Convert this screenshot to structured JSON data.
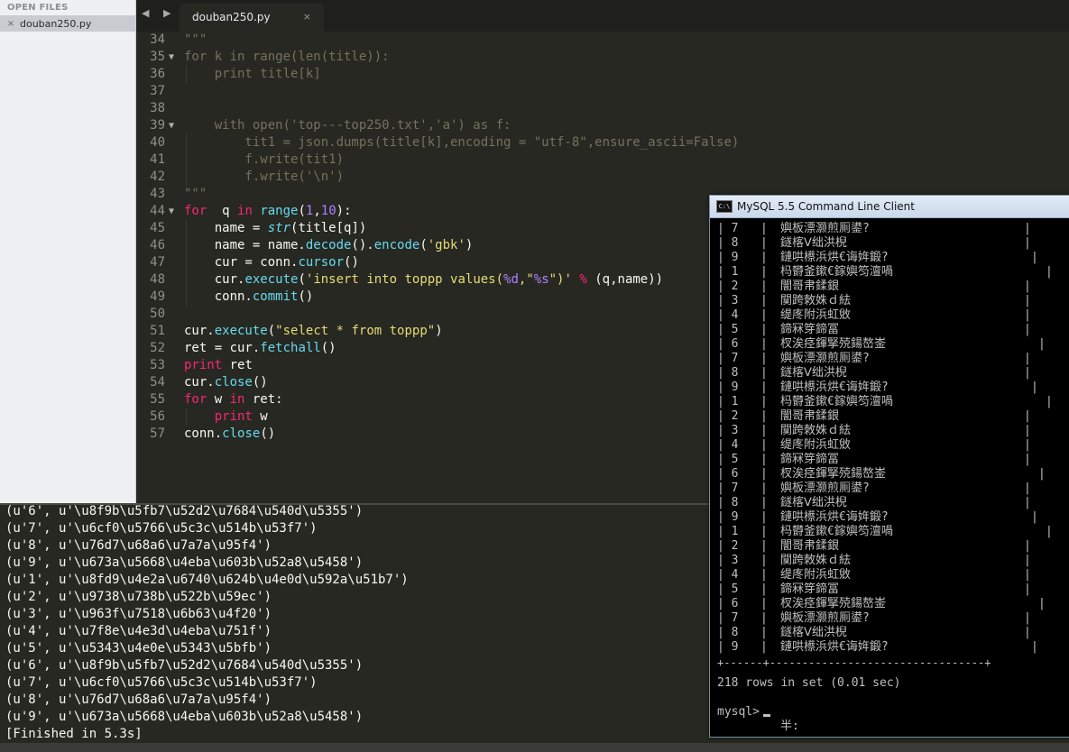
{
  "sidebar": {
    "header": "OPEN FILES",
    "close_icon": "×",
    "file": "douban250.py"
  },
  "tab": {
    "label": "douban250.py",
    "close": "×"
  },
  "nav": {
    "arrows": "◀ ▶"
  },
  "editor": {
    "lines": [
      {
        "n": "34",
        "fold": false,
        "tokens": [
          [
            "cm",
            "\"\"\""
          ]
        ]
      },
      {
        "n": "35",
        "fold": true,
        "tokens": [
          [
            "cm",
            "for k in range(len(title)):"
          ]
        ]
      },
      {
        "n": "36",
        "fold": false,
        "tokens": [
          [
            "cm",
            "    print title[k]"
          ]
        ]
      },
      {
        "n": "37",
        "fold": false,
        "tokens": []
      },
      {
        "n": "38",
        "fold": false,
        "tokens": []
      },
      {
        "n": "39",
        "fold": true,
        "tokens": [
          [
            "cm",
            "    with open('top---top250.txt','a') as f:"
          ]
        ]
      },
      {
        "n": "40",
        "fold": false,
        "tokens": [
          [
            "cm",
            "        tit1 = json.dumps(title[k],encoding = \"utf-8\",ensure_ascii=False)"
          ]
        ]
      },
      {
        "n": "41",
        "fold": false,
        "tokens": [
          [
            "cm",
            "        f.write(tit1)"
          ]
        ]
      },
      {
        "n": "42",
        "fold": false,
        "tokens": [
          [
            "cm",
            "        f.write('\\n')"
          ]
        ]
      },
      {
        "n": "43",
        "fold": false,
        "tokens": [
          [
            "cm",
            "\"\"\""
          ]
        ]
      },
      {
        "n": "44",
        "fold": true,
        "tokens": [
          [
            "kw",
            "for"
          ],
          [
            "",
            "  q "
          ],
          [
            "kw",
            "in"
          ],
          [
            "",
            " "
          ],
          [
            "fn",
            "range"
          ],
          [
            "",
            "("
          ],
          [
            "nm",
            "1"
          ],
          [
            "",
            ","
          ],
          [
            "nm",
            "10"
          ],
          [
            "",
            "):"
          ]
        ]
      },
      {
        "n": "45",
        "fold": false,
        "tokens": [
          [
            "",
            "    name = "
          ],
          [
            "bi",
            "str"
          ],
          [
            "",
            "(title[q])"
          ]
        ]
      },
      {
        "n": "46",
        "fold": false,
        "tokens": [
          [
            "",
            "    name = name."
          ],
          [
            "fn",
            "decode"
          ],
          [
            "",
            "()."
          ],
          [
            "fn",
            "encode"
          ],
          [
            "",
            "("
          ],
          [
            "st",
            "'gbk'"
          ],
          [
            "",
            ")"
          ]
        ]
      },
      {
        "n": "47",
        "fold": false,
        "tokens": [
          [
            "",
            "    cur = conn."
          ],
          [
            "fn",
            "cursor"
          ],
          [
            "",
            "()"
          ]
        ]
      },
      {
        "n": "48",
        "fold": false,
        "tokens": [
          [
            "",
            "    cur."
          ],
          [
            "fn",
            "execute"
          ],
          [
            "",
            "("
          ],
          [
            "st",
            "'insert into toppp values("
          ],
          [
            "nm",
            "%d"
          ],
          [
            "st",
            ",\""
          ],
          [
            "nm",
            "%s"
          ],
          [
            "st",
            "\")'"
          ],
          [
            "",
            " "
          ],
          [
            "kw",
            "%"
          ],
          [
            "",
            " (q,name))"
          ]
        ]
      },
      {
        "n": "49",
        "fold": false,
        "tokens": [
          [
            "",
            "    conn."
          ],
          [
            "fn",
            "commit"
          ],
          [
            "",
            "()"
          ]
        ]
      },
      {
        "n": "50",
        "fold": false,
        "tokens": []
      },
      {
        "n": "51",
        "fold": false,
        "tokens": [
          [
            "",
            "cur."
          ],
          [
            "fn",
            "execute"
          ],
          [
            "",
            "("
          ],
          [
            "st",
            "\"select * from toppp\""
          ],
          [
            "",
            ")"
          ]
        ]
      },
      {
        "n": "52",
        "fold": false,
        "tokens": [
          [
            "",
            "ret = cur."
          ],
          [
            "fn",
            "fetchall"
          ],
          [
            "",
            "()"
          ]
        ]
      },
      {
        "n": "53",
        "fold": false,
        "tokens": [
          [
            "kw",
            "print"
          ],
          [
            "",
            " ret"
          ]
        ]
      },
      {
        "n": "54",
        "fold": false,
        "tokens": [
          [
            "",
            "cur."
          ],
          [
            "fn",
            "close"
          ],
          [
            "",
            "()"
          ]
        ]
      },
      {
        "n": "55",
        "fold": false,
        "tokens": [
          [
            "kw",
            "for"
          ],
          [
            "",
            " w "
          ],
          [
            "kw",
            "in"
          ],
          [
            "",
            " ret:"
          ]
        ]
      },
      {
        "n": "56",
        "fold": false,
        "tokens": [
          [
            "",
            "    "
          ],
          [
            "kw",
            "print"
          ],
          [
            "",
            " w"
          ]
        ]
      },
      {
        "n": "57",
        "fold": false,
        "tokens": [
          [
            "",
            "conn."
          ],
          [
            "fn",
            "close"
          ],
          [
            "",
            "()"
          ]
        ]
      }
    ]
  },
  "output": {
    "lines": [
      "(u'6', u'\\u8f9b\\u5fb7\\u52d2\\u7684\\u540d\\u5355')",
      "(u'7', u'\\u6cf0\\u5766\\u5c3c\\u514b\\u53f7')",
      "(u'8', u'\\u76d7\\u68a6\\u7a7a\\u95f4')",
      "(u'9', u'\\u673a\\u5668\\u4eba\\u603b\\u52a8\\u5458')",
      "(u'1', u'\\u8fd9\\u4e2a\\u6740\\u624b\\u4e0d\\u592a\\u51b7')",
      "(u'2', u'\\u9738\\u738b\\u522b\\u59ec')",
      "(u'3', u'\\u963f\\u7518\\u6b63\\u4f20')",
      "(u'4', u'\\u7f8e\\u4e3d\\u4eba\\u751f')",
      "(u'5', u'\\u5343\\u4e0e\\u5343\\u5bfb')",
      "(u'6', u'\\u8f9b\\u5fb7\\u52d2\\u7684\\u540d\\u5355')",
      "(u'7', u'\\u6cf0\\u5766\\u5c3c\\u514b\\u53f7')",
      "(u'8', u'\\u76d7\\u68a6\\u7a7a\\u95f4')",
      "(u'9', u'\\u673a\\u5668\\u4eba\\u603b\\u52a8\\u5458')",
      "[Finished in 5.3s]"
    ]
  },
  "mysql": {
    "title": "MySQL 5.5 Command Line Client",
    "icon_text": "C:\\",
    "rows": [
      {
        "id": "7",
        "name": "嬩板漂灏煎厠鍙?",
        "tail": 340
      },
      {
        "id": "8",
        "name": "鐩楁Ⅴ绌洪棿",
        "tail": 340
      },
      {
        "id": "9",
        "name": "鏈哄櫒浜烘€诲姩鍛?",
        "tail": 348
      },
      {
        "id": "1",
        "name": "杩欎釜鏉€鎵嬩笉澶喎",
        "tail": 364
      },
      {
        "id": "2",
        "name": "闇哥帇鍒銀",
        "tail": 340
      },
      {
        "id": "3",
        "name": "闃跨敇姝ｄ紶",
        "tail": 340
      },
      {
        "id": "4",
        "name": "缇庝附浜虹敓",
        "tail": 340
      },
      {
        "id": "5",
        "name": "鍗冧笌鍗冨",
        "tail": 340
      },
      {
        "id": "6",
        "name": "杈涘痉鍕掔殑鍚嶅崟",
        "tail": 356
      },
      {
        "id": "7",
        "name": "嬩板漂灏煎厠鍙?",
        "tail": 340
      },
      {
        "id": "8",
        "name": "鐩楁Ⅴ绌洪棿",
        "tail": 340
      },
      {
        "id": "9",
        "name": "鏈哄櫒浜烘€诲姩鍛?",
        "tail": 348
      },
      {
        "id": "1",
        "name": "杩欎釜鏉€鎵嬩笉澶喎",
        "tail": 364
      },
      {
        "id": "2",
        "name": "闇哥帇鍒銀",
        "tail": 340
      },
      {
        "id": "3",
        "name": "闃跨敇姝ｄ紶",
        "tail": 340
      },
      {
        "id": "4",
        "name": "缇庝附浜虹敓",
        "tail": 340
      },
      {
        "id": "5",
        "name": "鍗冧笌鍗冨",
        "tail": 340
      },
      {
        "id": "6",
        "name": "杈涘痉鍕掔殑鍚嶅崟",
        "tail": 356
      },
      {
        "id": "7",
        "name": "嬩板漂灏煎厠鍙?",
        "tail": 340
      },
      {
        "id": "8",
        "name": "鐩楁Ⅴ绌洪棿",
        "tail": 340
      },
      {
        "id": "9",
        "name": "鏈哄櫒浜烘€诲姩鍛?",
        "tail": 348
      },
      {
        "id": "1",
        "name": "杩欎釜鏉€鎵嬩笉澶喎",
        "tail": 364
      },
      {
        "id": "2",
        "name": "闇哥帇鍒銀",
        "tail": 340
      },
      {
        "id": "3",
        "name": "闃跨敇姝ｄ紶",
        "tail": 340
      },
      {
        "id": "4",
        "name": "缇庝附浜虹敓",
        "tail": 340
      },
      {
        "id": "5",
        "name": "鍗冧笌鍗冨",
        "tail": 340
      },
      {
        "id": "6",
        "name": "杈涘痉鍕掔殑鍚嶅崟",
        "tail": 356
      },
      {
        "id": "7",
        "name": "嬩板漂灏煎厠鍙?",
        "tail": 340
      },
      {
        "id": "8",
        "name": "鐩楁Ⅴ绌洪棿",
        "tail": 340
      },
      {
        "id": "9",
        "name": "鏈哄櫒浜烘€诲姩鍛?",
        "tail": 348
      }
    ],
    "separator": "+------+---------------------------------+",
    "summary": "218 rows in set (0.01 sec)",
    "prompt": "mysql>",
    "ime": "半:"
  }
}
